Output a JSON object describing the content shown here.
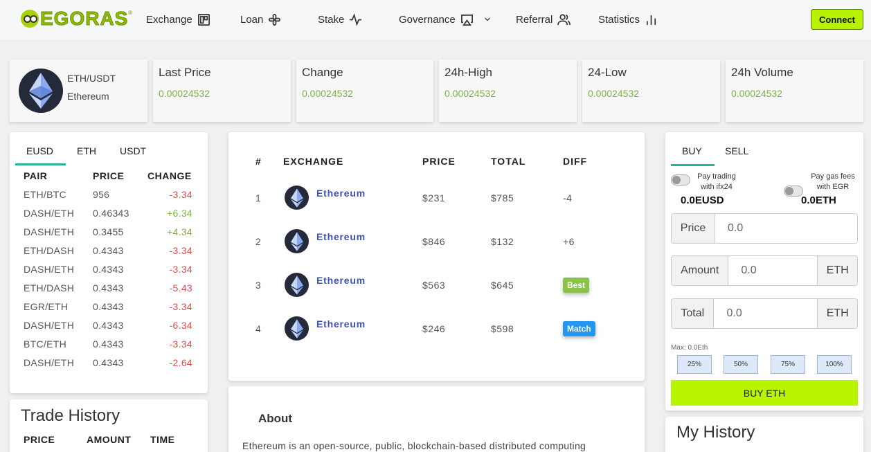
{
  "brand": {
    "logo_text": "EGORAS",
    "registered": "®"
  },
  "nav": {
    "exchange": "Exchange",
    "loan": "Loan",
    "stake": "Stake",
    "governance": "Governance",
    "referral": "Referral",
    "statistics": "Statistics",
    "connect": "Connect"
  },
  "pair": {
    "symbol": "ETH/USDT",
    "name": "Ethereum"
  },
  "ticker": [
    {
      "label": "Last Price",
      "value": "0.00024532"
    },
    {
      "label": "Change",
      "value": "0.00024532"
    },
    {
      "label": "24h-High",
      "value": "0.00024532"
    },
    {
      "label": "24-Low",
      "value": "0.00024532"
    },
    {
      "label": "24h Volume",
      "value": "0.00024532"
    }
  ],
  "market": {
    "tabs": [
      "EUSD",
      "ETH",
      "USDT"
    ],
    "headers": [
      "PAIR",
      "PRICE",
      "CHANGE"
    ],
    "rows": [
      {
        "pair": "ETH/BTC",
        "price": "956",
        "change": "-3.34",
        "dir": "neg"
      },
      {
        "pair": "DASH/ETH",
        "price": "0.46343",
        "change": "+6.34",
        "dir": "pos"
      },
      {
        "pair": "DASH/ETH",
        "price": "0.3455",
        "change": "+4.34",
        "dir": "pos"
      },
      {
        "pair": "ETH/DASH",
        "price": "0.4343",
        "change": "-3.34",
        "dir": "neg"
      },
      {
        "pair": "DASH/ETH",
        "price": "0.4343",
        "change": "-3.34",
        "dir": "neg"
      },
      {
        "pair": "ETH/DASH",
        "price": "0.4343",
        "change": "-5.43",
        "dir": "neg"
      },
      {
        "pair": "EGR/ETH",
        "price": "0.4343",
        "change": "-3.34",
        "dir": "neg"
      },
      {
        "pair": "DASH/ETH",
        "price": "0.4343",
        "change": "-6.34",
        "dir": "neg"
      },
      {
        "pair": "BTC/ETH",
        "price": "0.4343",
        "change": "-3.34",
        "dir": "neg"
      },
      {
        "pair": "DASH/ETH",
        "price": "0.4343",
        "change": "-2.64",
        "dir": "neg"
      }
    ]
  },
  "trade_history": {
    "title": "Trade History",
    "headers": [
      "PRICE",
      "AMOUNT",
      "TIME"
    ]
  },
  "exchange_table": {
    "headers": [
      "#",
      "EXCHANGE",
      "PRICE",
      "TOTAL",
      "DIFF"
    ],
    "rows": [
      {
        "num": "1",
        "name": "Ethereum",
        "price": "$231",
        "total": "$785",
        "diff": "-4",
        "kind": "neg"
      },
      {
        "num": "2",
        "name": "Ethereum",
        "price": "$846",
        "total": "$132",
        "diff": "+6",
        "kind": "pos"
      },
      {
        "num": "3",
        "name": "Ethereum",
        "price": "$563",
        "total": "$645",
        "diff": "Best",
        "kind": "best"
      },
      {
        "num": "4",
        "name": "Ethereum",
        "price": "$246",
        "total": "$598",
        "diff": "Match",
        "kind": "match"
      }
    ]
  },
  "about": {
    "title": "About",
    "text": "Ethereum is an open-source, public, blockchain-based distributed computing"
  },
  "trade_panel": {
    "tabs": [
      "BUY",
      "SELL"
    ],
    "toggle_ifx": [
      "Pay trading",
      "with ifx24"
    ],
    "toggle_egr": [
      "Pay gas fees",
      "with EGR"
    ],
    "balance_eusd": "0.0EUSD",
    "balance_eth": "0.0ETH",
    "price_label": "Price",
    "price_value": "0.0",
    "amount_label": "Amount",
    "amount_value": "0.0",
    "amount_unit": "ETH",
    "total_label": "Total",
    "total_value": "0.0",
    "total_unit": "ETH",
    "max": "Max: 0.0Eth",
    "percents": [
      "25%",
      "50%",
      "75%",
      "100%"
    ],
    "buy_button": "BUY ETH"
  },
  "my_history": {
    "title": "My History"
  },
  "colors": {
    "accent": "#b7f300",
    "positive": "#7cb342",
    "negative": "#e04b4b",
    "link": "#3f51b5",
    "tab_underline": "#26b497"
  }
}
